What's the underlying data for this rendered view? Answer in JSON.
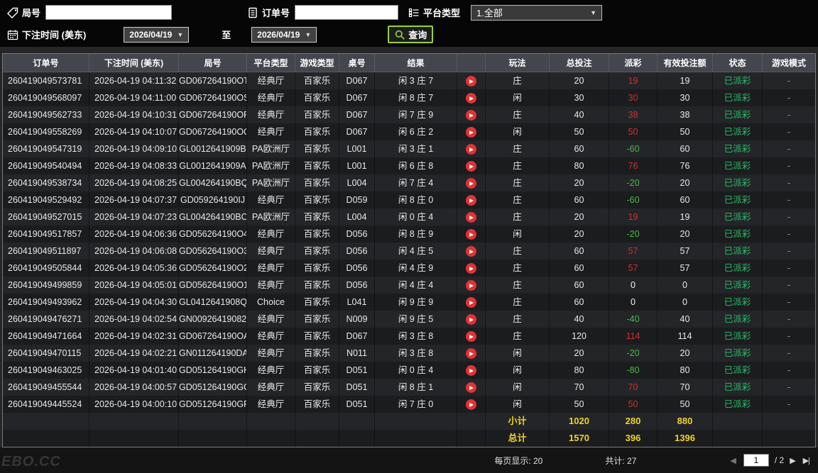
{
  "topbar": {
    "game_no_label": "局号",
    "order_no_label": "订单号",
    "platform_label": "平台类型",
    "platform_value": "1.全部",
    "bet_time_label": "下注时间 (美东)",
    "date_from": "2026/04/19",
    "to_label": "至",
    "date_to": "2026/04/19",
    "search_label": "查询",
    "caret": "▼"
  },
  "table": {
    "headers": [
      "订单号",
      "下注时间 (美东)",
      "局号",
      "平台类型",
      "游戏类型",
      "桌号",
      "结果",
      "",
      "玩法",
      "总投注",
      "派彩",
      "有效投注额",
      "状态",
      "游戏模式"
    ],
    "rows": [
      {
        "order": "260419049573781",
        "time": "2026-04-19 04:11:32",
        "game": "GD067264190OT",
        "plat": "经典厅",
        "gtype": "百家乐",
        "tbl": "D067",
        "result": "闲 3 庄 7",
        "side": "庄",
        "bet": "20",
        "pay": "19",
        "valid": "19",
        "status": "已派彩",
        "mode": "-"
      },
      {
        "order": "260419049568097",
        "time": "2026-04-19 04:11:00",
        "game": "GD067264190OS",
        "plat": "经典厅",
        "gtype": "百家乐",
        "tbl": "D067",
        "result": "闲 8 庄 7",
        "side": "闲",
        "bet": "30",
        "pay": "30",
        "valid": "30",
        "status": "已派彩",
        "mode": "-"
      },
      {
        "order": "260419049562733",
        "time": "2026-04-19 04:10:31",
        "game": "GD067264190OR",
        "plat": "经典厅",
        "gtype": "百家乐",
        "tbl": "D067",
        "result": "闲 7 庄 9",
        "side": "庄",
        "bet": "40",
        "pay": "38",
        "valid": "38",
        "status": "已派彩",
        "mode": "-"
      },
      {
        "order": "260419049558269",
        "time": "2026-04-19 04:10:07",
        "game": "GD067264190OQ",
        "plat": "经典厅",
        "gtype": "百家乐",
        "tbl": "D067",
        "result": "闲 6 庄 2",
        "side": "闲",
        "bet": "50",
        "pay": "50",
        "valid": "50",
        "status": "已派彩",
        "mode": "-"
      },
      {
        "order": "260419049547319",
        "time": "2026-04-19 04:09:10",
        "game": "GL0012641909B",
        "plat": "PA欧洲厅",
        "gtype": "百家乐",
        "tbl": "L001",
        "result": "闲 3 庄 1",
        "side": "庄",
        "bet": "60",
        "pay": "-60",
        "valid": "60",
        "status": "已派彩",
        "mode": "-"
      },
      {
        "order": "260419049540494",
        "time": "2026-04-19 04:08:33",
        "game": "GL0012641909A",
        "plat": "PA欧洲厅",
        "gtype": "百家乐",
        "tbl": "L001",
        "result": "闲 6 庄 8",
        "side": "庄",
        "bet": "80",
        "pay": "76",
        "valid": "76",
        "status": "已派彩",
        "mode": "-"
      },
      {
        "order": "260419049538734",
        "time": "2026-04-19 04:08:25",
        "game": "GL004264190BQ",
        "plat": "PA欧洲厅",
        "gtype": "百家乐",
        "tbl": "L004",
        "result": "闲 7 庄 4",
        "side": "庄",
        "bet": "20",
        "pay": "-20",
        "valid": "20",
        "status": "已派彩",
        "mode": "-"
      },
      {
        "order": "260419049529492",
        "time": "2026-04-19 04:07:37",
        "game": "GD059264190IJ",
        "plat": "经典厅",
        "gtype": "百家乐",
        "tbl": "D059",
        "result": "闲 8 庄 0",
        "side": "庄",
        "bet": "60",
        "pay": "-60",
        "valid": "60",
        "status": "已派彩",
        "mode": "-"
      },
      {
        "order": "260419049527015",
        "time": "2026-04-19 04:07:23",
        "game": "GL004264190BO",
        "plat": "PA欧洲厅",
        "gtype": "百家乐",
        "tbl": "L004",
        "result": "闲 0 庄 4",
        "side": "庄",
        "bet": "20",
        "pay": "19",
        "valid": "19",
        "status": "已派彩",
        "mode": "-"
      },
      {
        "order": "260419049517857",
        "time": "2026-04-19 04:06:36",
        "game": "GD056264190O4",
        "plat": "经典厅",
        "gtype": "百家乐",
        "tbl": "D056",
        "result": "闲 8 庄 9",
        "side": "闲",
        "bet": "20",
        "pay": "-20",
        "valid": "20",
        "status": "已派彩",
        "mode": "-"
      },
      {
        "order": "260419049511897",
        "time": "2026-04-19 04:06:08",
        "game": "GD056264190O3",
        "plat": "经典厅",
        "gtype": "百家乐",
        "tbl": "D056",
        "result": "闲 4 庄 5",
        "side": "庄",
        "bet": "60",
        "pay": "57",
        "valid": "57",
        "status": "已派彩",
        "mode": "-"
      },
      {
        "order": "260419049505844",
        "time": "2026-04-19 04:05:36",
        "game": "GD056264190O2",
        "plat": "经典厅",
        "gtype": "百家乐",
        "tbl": "D056",
        "result": "闲 4 庄 9",
        "side": "庄",
        "bet": "60",
        "pay": "57",
        "valid": "57",
        "status": "已派彩",
        "mode": "-"
      },
      {
        "order": "260419049499859",
        "time": "2026-04-19 04:05:01",
        "game": "GD056264190O1",
        "plat": "经典厅",
        "gtype": "百家乐",
        "tbl": "D056",
        "result": "闲 4 庄 4",
        "side": "庄",
        "bet": "60",
        "pay": "0",
        "valid": "0",
        "status": "已派彩",
        "mode": "-"
      },
      {
        "order": "260419049493962",
        "time": "2026-04-19 04:04:30",
        "game": "GL0412641908Q",
        "plat": "Choice",
        "gtype": "百家乐",
        "tbl": "L041",
        "result": "闲 9 庄 9",
        "side": "庄",
        "bet": "60",
        "pay": "0",
        "valid": "0",
        "status": "已派彩",
        "mode": "-"
      },
      {
        "order": "260419049476271",
        "time": "2026-04-19 04:02:54",
        "game": "GN00926419082",
        "plat": "经典厅",
        "gtype": "百家乐",
        "tbl": "N009",
        "result": "闲 9 庄 5",
        "side": "庄",
        "bet": "40",
        "pay": "-40",
        "valid": "40",
        "status": "已派彩",
        "mode": "-"
      },
      {
        "order": "260419049471664",
        "time": "2026-04-19 04:02:31",
        "game": "GD067264190OA",
        "plat": "经典厅",
        "gtype": "百家乐",
        "tbl": "D067",
        "result": "闲 3 庄 8",
        "side": "庄",
        "bet": "120",
        "pay": "114",
        "valid": "114",
        "status": "已派彩",
        "mode": "-"
      },
      {
        "order": "260419049470115",
        "time": "2026-04-19 04:02:21",
        "game": "GN011264190DA",
        "plat": "经典厅",
        "gtype": "百家乐",
        "tbl": "N011",
        "result": "闲 3 庄 8",
        "side": "闲",
        "bet": "20",
        "pay": "-20",
        "valid": "20",
        "status": "已派彩",
        "mode": "-"
      },
      {
        "order": "260419049463025",
        "time": "2026-04-19 04:01:40",
        "game": "GD051264190GH",
        "plat": "经典厅",
        "gtype": "百家乐",
        "tbl": "D051",
        "result": "闲 0 庄 4",
        "side": "闲",
        "bet": "80",
        "pay": "-80",
        "valid": "80",
        "status": "已派彩",
        "mode": "-"
      },
      {
        "order": "260419049455544",
        "time": "2026-04-19 04:00:57",
        "game": "GD051264190GG",
        "plat": "经典厅",
        "gtype": "百家乐",
        "tbl": "D051",
        "result": "闲 8 庄 1",
        "side": "闲",
        "bet": "70",
        "pay": "70",
        "valid": "70",
        "status": "已派彩",
        "mode": "-"
      },
      {
        "order": "260419049445524",
        "time": "2026-04-19 04:00:10",
        "game": "GD051264190GF",
        "plat": "经典厅",
        "gtype": "百家乐",
        "tbl": "D051",
        "result": "闲 7 庄 0",
        "side": "闲",
        "bet": "50",
        "pay": "50",
        "valid": "50",
        "status": "已派彩",
        "mode": "-"
      }
    ],
    "subtotal": {
      "label": "小计",
      "bet": "1020",
      "pay": "280",
      "valid": "880"
    },
    "total": {
      "label": "总计",
      "bet": "1570",
      "pay": "396",
      "valid": "1396"
    }
  },
  "footer": {
    "watermark": "EBO.CC",
    "per_page": "每页显示: 20",
    "total_count": "共计: 27",
    "page_value": "1",
    "page_total": "/ 2",
    "prev_icon": "◀",
    "next_icon": "▶",
    "last_icon": "▶|"
  }
}
